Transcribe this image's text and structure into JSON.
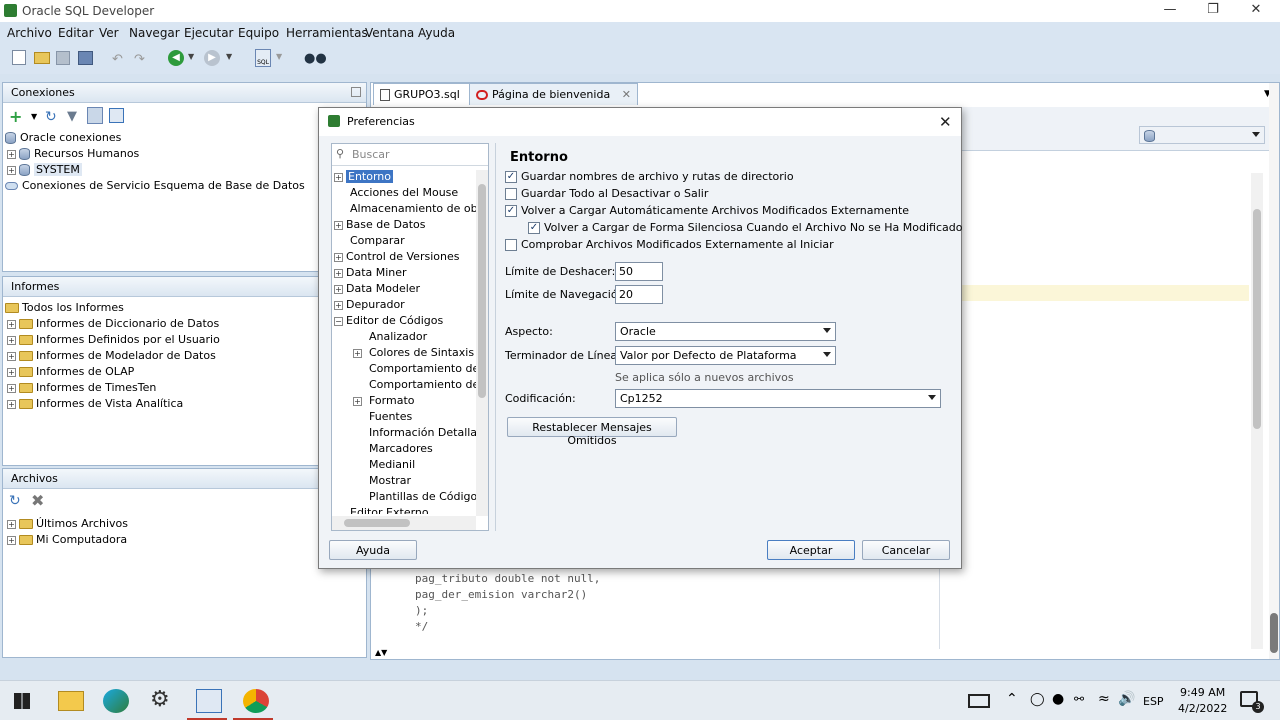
{
  "window": {
    "title": "Oracle SQL Developer"
  },
  "menu": [
    "Archivo",
    "Editar",
    "Ver",
    "Navegar",
    "Ejecutar",
    "Equipo",
    "Herramientas",
    "Ventana",
    "Ayuda"
  ],
  "connections": {
    "header": "Conexiones",
    "items": [
      "Oracle conexiones",
      "Recursos Humanos",
      "SYSTEM",
      "Conexiones de Servicio Esquema de Base de Datos"
    ]
  },
  "reports": {
    "header": "Informes",
    "items": [
      "Todos los Informes",
      "Informes de Diccionario de Datos",
      "Informes Definidos por el Usuario",
      "Informes de Modelador de Datos",
      "Informes de OLAP",
      "Informes de TimesTen",
      "Informes de Vista Analítica"
    ]
  },
  "files": {
    "header": "Archivos",
    "items": [
      "Últimos Archivos",
      "Mi Computadora"
    ]
  },
  "editor": {
    "tabs": [
      "GRUPO3.sql",
      "Página de bienvenida"
    ],
    "code_lines": [
      "pag_tributo double not null,",
      "pag_der_emision varchar2()",
      ");",
      "*/"
    ]
  },
  "dialog": {
    "title": "Preferencias",
    "search_placeholder": "Buscar",
    "tree": [
      "Entorno",
      "Acciones del Mouse",
      "Almacenamiento de objetos",
      "Base de Datos",
      "Comparar",
      "Control de Versiones",
      "Data Miner",
      "Data Modeler",
      "Depurador",
      "Editor de Códigos",
      "Analizador",
      "Colores de Sintaxis PL/",
      "Comportamiento de De",
      "Comportamiento del Sir",
      "Formato",
      "Fuentes",
      "Información Detallada d",
      "Marcadores",
      "Medianil",
      "Mostrar",
      "Plantillas de Código",
      "Editor Externo"
    ],
    "section_title": "Entorno",
    "options": [
      {
        "label": "Guardar nombres de archivo y rutas de directorio",
        "checked": true
      },
      {
        "label": "Guardar Todo al Desactivar o Salir",
        "checked": false
      },
      {
        "label": "Volver a Cargar Automáticamente Archivos Modificados Externamente",
        "checked": true
      },
      {
        "label": "Volver a Cargar de Forma Silenciosa Cuando el Archivo No se Ha Modificado",
        "checked": true
      },
      {
        "label": "Comprobar Archivos Modificados Externamente al Iniciar",
        "checked": false
      }
    ],
    "undo_label": "Límite de Deshacer:",
    "undo_value": "50",
    "nav_label": "Límite de Navegación:",
    "nav_value": "20",
    "look_label": "Aspecto:",
    "look_value": "Oracle",
    "eol_label": "Terminador de Línea:",
    "eol_value": "Valor por Defecto de Plataforma",
    "eol_note": "Se aplica sólo a nuevos archivos",
    "enc_label": "Codificación:",
    "enc_value": "Cp1252",
    "reset_button": "Restablecer Mensajes Omitidos",
    "help_button": "Ayuda",
    "ok_button": "Aceptar",
    "cancel_button": "Cancelar"
  },
  "taskbar": {
    "lang": "ESP",
    "time": "9:49 AM",
    "date": "4/2/2022",
    "notif_count": "3"
  }
}
